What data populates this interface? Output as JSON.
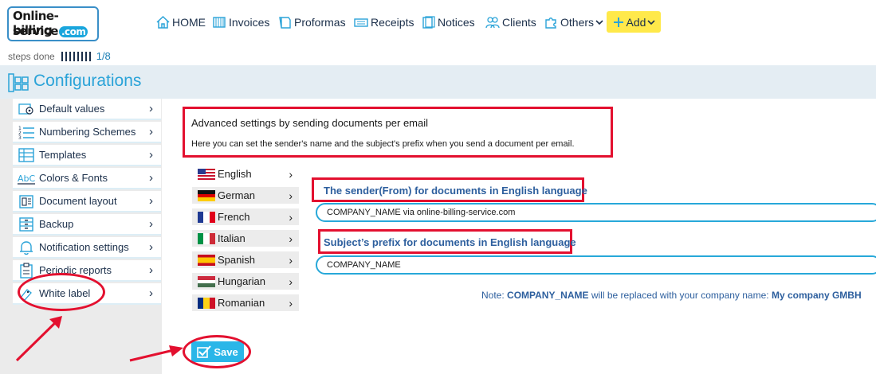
{
  "header": {
    "logo": {
      "line1": "Online-billing",
      "line2": "service",
      "suffix": ".com"
    },
    "nav": [
      {
        "label": "HOME",
        "icon": "home-icon"
      },
      {
        "label": "Invoices",
        "icon": "invoice-icon"
      },
      {
        "label": "Proformas",
        "icon": "proforma-icon"
      },
      {
        "label": "Receipts",
        "icon": "receipt-icon"
      },
      {
        "label": "Notices",
        "icon": "notice-icon"
      },
      {
        "label": "Clients",
        "icon": "clients-icon"
      },
      {
        "label": "Others",
        "icon": "puzzle-icon"
      }
    ],
    "add_label": "Add"
  },
  "steps": {
    "label": "steps done",
    "count": "1/8"
  },
  "page_title": "Configurations",
  "sidebar": {
    "items": [
      {
        "label": "Default values",
        "icon": "settings-doc-icon"
      },
      {
        "label": "Numbering Schemes",
        "icon": "numbered-list-icon"
      },
      {
        "label": "Templates",
        "icon": "template-grid-icon"
      },
      {
        "label": "Colors & Fonts",
        "icon": "abc-icon"
      },
      {
        "label": "Document layout",
        "icon": "layout-icon"
      },
      {
        "label": "Backup",
        "icon": "backup-icon"
      },
      {
        "label": "Notification settings",
        "icon": "bell-icon"
      },
      {
        "label": "Periodic reports",
        "icon": "clipboard-icon"
      },
      {
        "label": "White label",
        "icon": "white-label-icon"
      }
    ]
  },
  "intro": {
    "title": "Advanced settings by sending documents per email",
    "description": "Here you can set the sender's name and the subject's prefix when you send a document per email."
  },
  "languages": [
    {
      "label": "English",
      "flag": "us"
    },
    {
      "label": "German",
      "flag": "de"
    },
    {
      "label": "French",
      "flag": "fr"
    },
    {
      "label": "Italian",
      "flag": "it"
    },
    {
      "label": "Spanish",
      "flag": "es"
    },
    {
      "label": "Hungarian",
      "flag": "hu"
    },
    {
      "label": "Romanian",
      "flag": "ro"
    }
  ],
  "sender": {
    "label": "The sender(From) for documents in English language",
    "value": "COMPANY_NAME via online-billing-service.com"
  },
  "subject": {
    "label": "Subject’s prefix for documents in English language",
    "value": "COMPANY_NAME"
  },
  "note": {
    "prefix": "Note:",
    "placeholder": "COMPANY_NAME",
    "middle": "will be replaced with your company name:",
    "company": "My company GMBH"
  },
  "save_label": "Save",
  "colors": {
    "accent": "#2ab6e8",
    "highlight": "#e3102f",
    "add": "#ffe94a",
    "nav_text": "#1b2f4a",
    "label_blue": "#2d5f9e"
  }
}
